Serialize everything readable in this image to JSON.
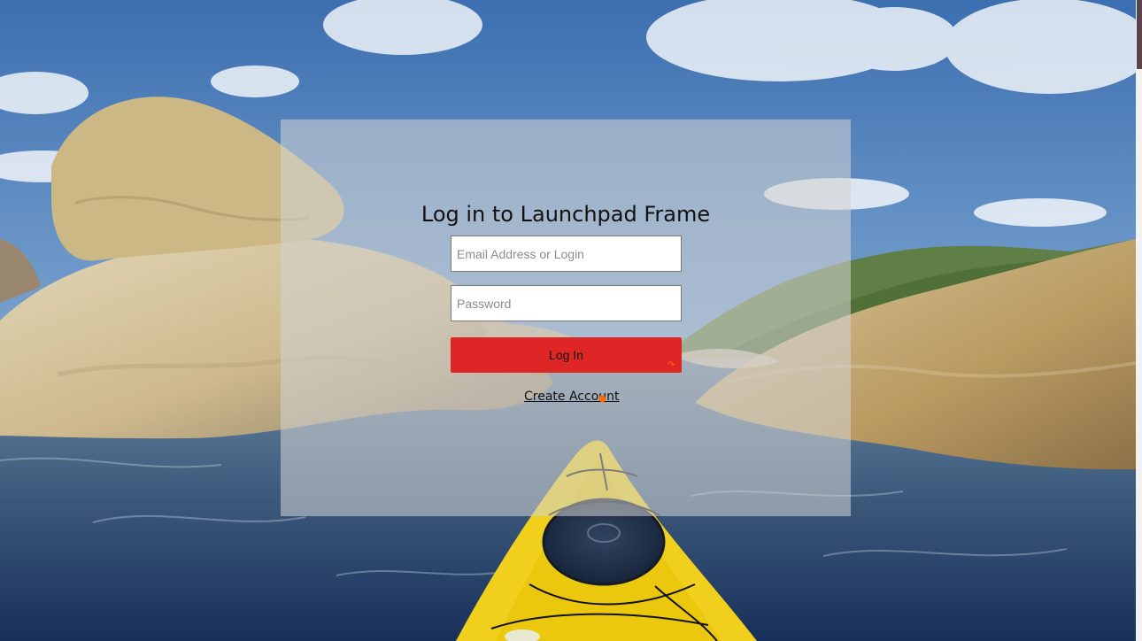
{
  "login": {
    "title": "Log in to Launchpad Frame",
    "email_placeholder": "Email Address or Login",
    "password_placeholder": "Password",
    "submit_label": "Log In",
    "create_account_label": "Create Account"
  },
  "theme": {
    "accent": "#de2626",
    "panel_overlay": "rgba(210, 210, 210, 0.56)",
    "scrollbar_thumb": "#5b434b"
  },
  "icons": {
    "background_scene": "kayak-on-river-background",
    "cursor_marks": [
      "orange-cursor-mark-icon",
      "orange-cursor-dot-icon"
    ]
  }
}
